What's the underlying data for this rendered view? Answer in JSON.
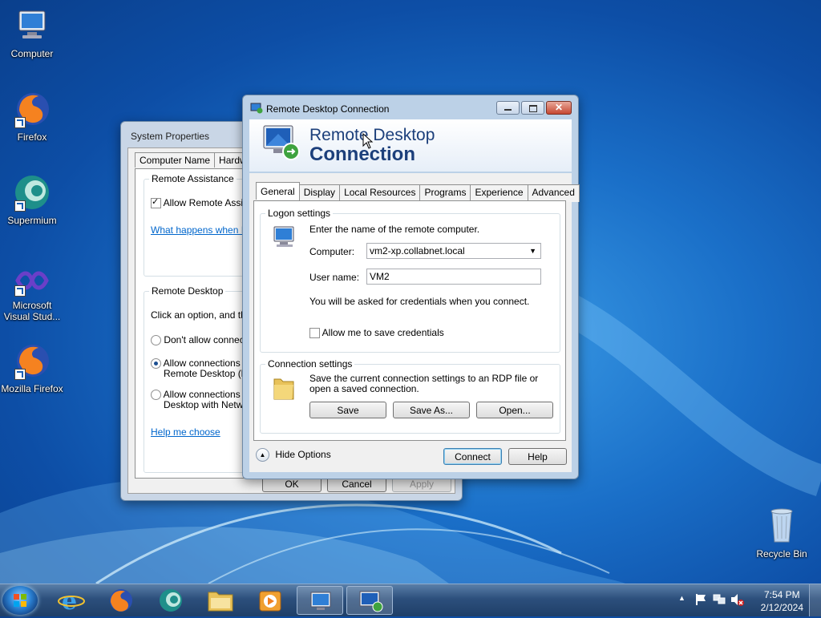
{
  "desktop": {
    "icons": [
      {
        "label": "Computer"
      },
      {
        "label": "Firefox"
      },
      {
        "label": "Supermium"
      },
      {
        "label": "Microsoft Visual Stud..."
      },
      {
        "label": "Mozilla Firefox"
      },
      {
        "label": "Recycle Bin"
      }
    ]
  },
  "system_properties": {
    "title": "System Properties",
    "tabs": [
      "Computer Name",
      "Hardware"
    ],
    "remote_assistance": {
      "legend": "Remote Assistance",
      "allow_label": "Allow Remote Assista",
      "allow_checked": true,
      "link": "What happens when I e"
    },
    "remote_desktop": {
      "legend": "Remote Desktop",
      "instruction": "Click an option, and ther",
      "options": [
        {
          "label": "Don't allow connectio",
          "selected": false
        },
        {
          "label": "Allow connections fro",
          "label2": "Remote Desktop (les",
          "selected": true
        },
        {
          "label": "Allow connections or",
          "label2": "Desktop with Networ",
          "selected": false
        }
      ],
      "help_link": "Help me choose"
    },
    "buttons": {
      "ok": "OK",
      "cancel": "Cancel",
      "apply": "Apply"
    }
  },
  "rdc": {
    "title": "Remote Desktop Connection",
    "banner_line1": "Remote Desktop",
    "banner_line2": "Connection",
    "tabs": [
      "General",
      "Display",
      "Local Resources",
      "Programs",
      "Experience",
      "Advanced"
    ],
    "active_tab": "General",
    "logon": {
      "legend": "Logon settings",
      "prompt": "Enter the name of the remote computer.",
      "computer_label": "Computer:",
      "computer_value": "vm2-xp.collabnet.local",
      "username_label": "User name:",
      "username_value": "VM2",
      "credentials_note": "You will be asked for credentials when you connect.",
      "save_credentials_label": "Allow me to save credentials",
      "save_credentials_checked": false
    },
    "connection": {
      "legend": "Connection settings",
      "description": "Save the current connection settings to an RDP file or open a saved connection.",
      "save": "Save",
      "save_as": "Save As...",
      "open": "Open..."
    },
    "hide_options": "Hide Options",
    "connect": "Connect",
    "help": "Help"
  },
  "taskbar": {
    "clock_time": "7:54 PM",
    "clock_date": "2/12/2024",
    "pinned": [
      "internet-explorer-icon",
      "firefox-icon",
      "supermium-icon",
      "file-explorer-icon",
      "media-player-icon",
      "system-properties-icon",
      "remote-desktop-icon"
    ]
  },
  "colors": {
    "desktop_blue": "#1a6fc8",
    "title_text_blue": "#1c3f7b",
    "close_red": "#c64731",
    "link_blue": "#0066cc"
  }
}
